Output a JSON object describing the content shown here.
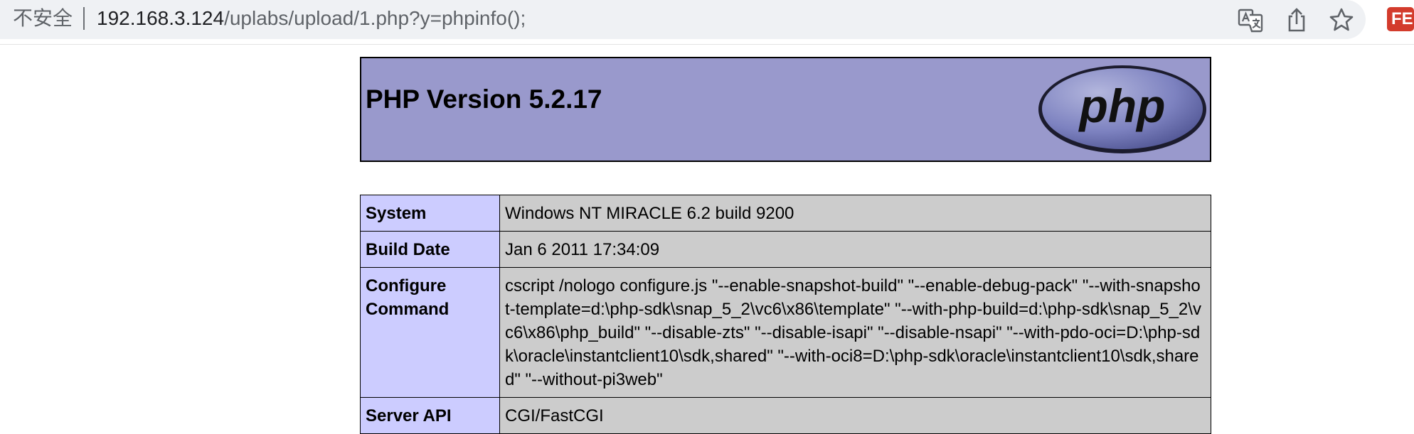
{
  "browser": {
    "security_label": "不安全",
    "url_host": "192.168.3.124",
    "url_path": "/uplabs/upload/1.php?y=phpinfo();",
    "extension_badge": "FE",
    "icons": [
      "warning-icon",
      "translate-icon",
      "share-icon",
      "star-icon",
      "extension-icon"
    ]
  },
  "phpinfo": {
    "title": "PHP Version 5.2.17",
    "logo_text": "php",
    "rows": [
      {
        "label": "System",
        "value": "Windows NT MIRACLE 6.2 build 9200"
      },
      {
        "label": "Build Date",
        "value": "Jan 6 2011 17:34:09"
      },
      {
        "label": "Configure Command",
        "value": "cscript /nologo configure.js \"--enable-snapshot-build\" \"--enable-debug-pack\" \"--with-snapshot-template=d:\\php-sdk\\snap_5_2\\vc6\\x86\\template\" \"--with-php-build=d:\\php-sdk\\snap_5_2\\vc6\\x86\\php_build\" \"--disable-zts\" \"--disable-isapi\" \"--disable-nsapi\" \"--with-pdo-oci=D:\\php-sdk\\oracle\\instantclient10\\sdk,shared\" \"--with-oci8=D:\\php-sdk\\oracle\\instantclient10\\sdk,shared\" \"--without-pi3web\""
      },
      {
        "label": "Server API",
        "value": "CGI/FastCGI"
      }
    ]
  },
  "colors": {
    "header_bg": "#9999cc",
    "label_bg": "#ccccff",
    "value_bg": "#cccccc",
    "omnibox_bg": "#eff1f4",
    "extension_red": "#d33b2c"
  }
}
